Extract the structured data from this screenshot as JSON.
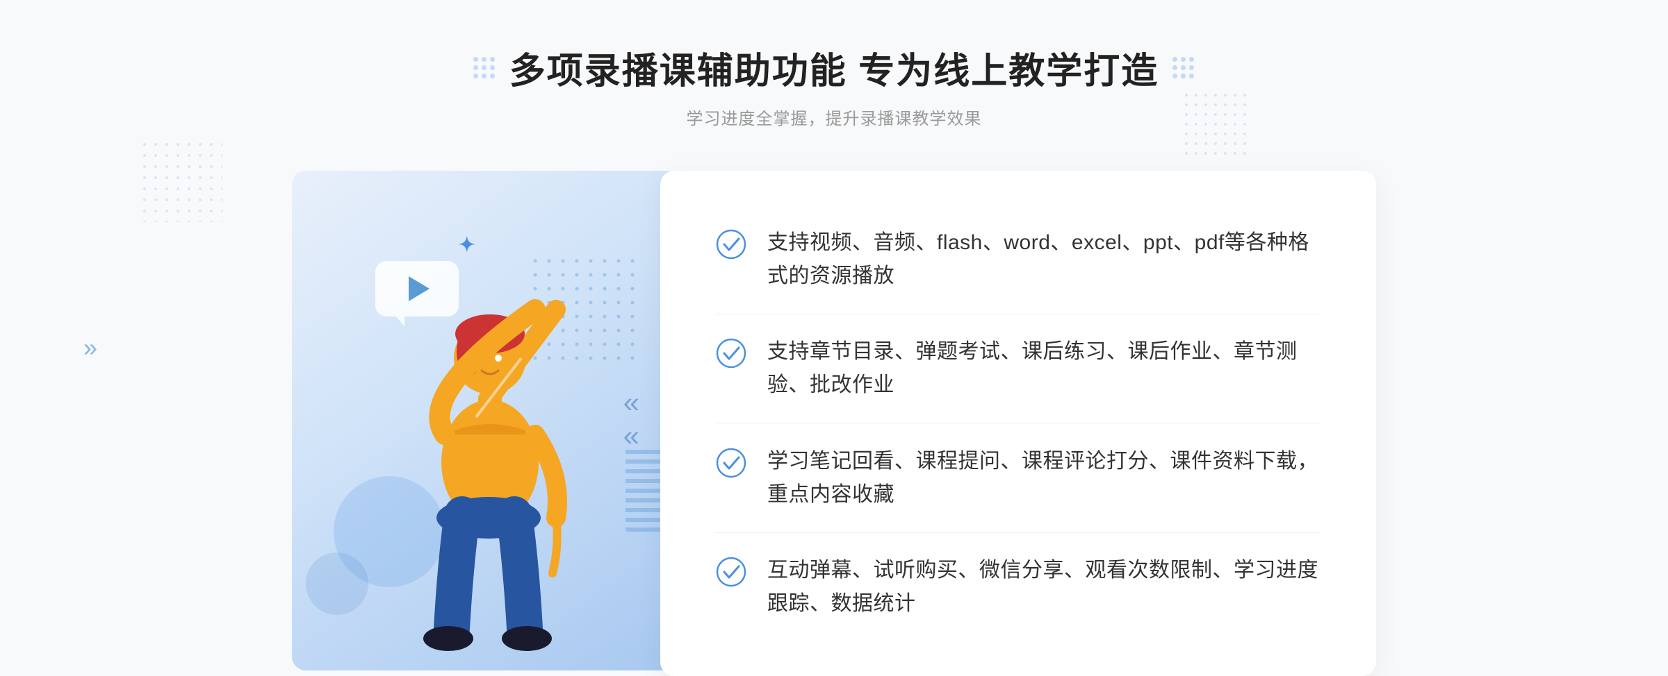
{
  "header": {
    "title": "多项录播课辅助功能 专为线上教学打造",
    "subtitle": "学习进度全掌握，提升录播课教学效果"
  },
  "features": [
    {
      "id": 1,
      "text": "支持视频、音频、flash、word、excel、ppt、pdf等各种格式的资源播放"
    },
    {
      "id": 2,
      "text": "支持章节目录、弹题考试、课后练习、课后作业、章节测验、批改作业"
    },
    {
      "id": 3,
      "text": "学习笔记回看、课程提问、课程评论打分、课件资料下载，重点内容收藏"
    },
    {
      "id": 4,
      "text": "互动弹幕、试听购买、微信分享、观看次数限制、学习进度跟踪、数据统计"
    }
  ],
  "icons": {
    "check": "check-circle-icon",
    "play": "play-icon",
    "chevron": "»"
  },
  "colors": {
    "primary": "#4a90e2",
    "accent": "#5b9bd5",
    "light_bg": "#f8f9fb",
    "card_bg": "#ffffff",
    "title": "#222222",
    "text": "#333333",
    "subtitle": "#999999"
  }
}
